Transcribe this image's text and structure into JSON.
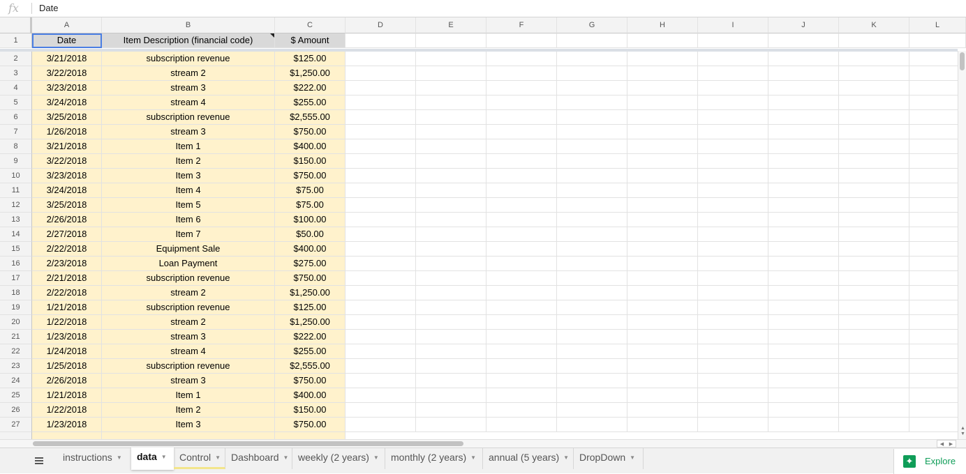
{
  "formula_bar": {
    "fx_label": "fx",
    "value": "Date"
  },
  "columns": [
    "A",
    "B",
    "C",
    "D",
    "E",
    "F",
    "G",
    "H",
    "I",
    "J",
    "K",
    "L"
  ],
  "header_row": {
    "row_num": "1",
    "date": "Date",
    "desc": "Item Description (financial code)",
    "amount": "$ Amount"
  },
  "rows": [
    {
      "n": "2",
      "date": "3/21/2018",
      "desc": "subscription revenue",
      "amount": "$125.00"
    },
    {
      "n": "3",
      "date": "3/22/2018",
      "desc": "stream 2",
      "amount": "$1,250.00"
    },
    {
      "n": "4",
      "date": "3/23/2018",
      "desc": "stream 3",
      "amount": "$222.00"
    },
    {
      "n": "5",
      "date": "3/24/2018",
      "desc": "stream 4",
      "amount": "$255.00"
    },
    {
      "n": "6",
      "date": "3/25/2018",
      "desc": "subscription revenue",
      "amount": "$2,555.00"
    },
    {
      "n": "7",
      "date": "1/26/2018",
      "desc": "stream 3",
      "amount": "$750.00"
    },
    {
      "n": "8",
      "date": "3/21/2018",
      "desc": "Item 1",
      "amount": "$400.00"
    },
    {
      "n": "9",
      "date": "3/22/2018",
      "desc": "Item 2",
      "amount": "$150.00"
    },
    {
      "n": "10",
      "date": "3/23/2018",
      "desc": "Item 3",
      "amount": "$750.00"
    },
    {
      "n": "11",
      "date": "3/24/2018",
      "desc": "Item 4",
      "amount": "$75.00"
    },
    {
      "n": "12",
      "date": "3/25/2018",
      "desc": "Item 5",
      "amount": "$75.00"
    },
    {
      "n": "13",
      "date": "2/26/2018",
      "desc": "Item 6",
      "amount": "$100.00"
    },
    {
      "n": "14",
      "date": "2/27/2018",
      "desc": "Item 7",
      "amount": "$50.00"
    },
    {
      "n": "15",
      "date": "2/22/2018",
      "desc": "Equipment Sale",
      "amount": "$400.00"
    },
    {
      "n": "16",
      "date": "2/23/2018",
      "desc": "Loan Payment",
      "amount": "$275.00"
    },
    {
      "n": "17",
      "date": "2/21/2018",
      "desc": "subscription revenue",
      "amount": "$750.00"
    },
    {
      "n": "18",
      "date": "2/22/2018",
      "desc": "stream 2",
      "amount": "$1,250.00"
    },
    {
      "n": "19",
      "date": "1/21/2018",
      "desc": "subscription revenue",
      "amount": "$125.00"
    },
    {
      "n": "20",
      "date": "1/22/2018",
      "desc": "stream 2",
      "amount": "$1,250.00"
    },
    {
      "n": "21",
      "date": "1/23/2018",
      "desc": "stream 3",
      "amount": "$222.00"
    },
    {
      "n": "22",
      "date": "1/24/2018",
      "desc": "stream 4",
      "amount": "$255.00"
    },
    {
      "n": "23",
      "date": "1/25/2018",
      "desc": "subscription revenue",
      "amount": "$2,555.00"
    },
    {
      "n": "24",
      "date": "2/26/2018",
      "desc": "stream 3",
      "amount": "$750.00"
    },
    {
      "n": "25",
      "date": "1/21/2018",
      "desc": "Item 1",
      "amount": "$400.00"
    },
    {
      "n": "26",
      "date": "1/22/2018",
      "desc": "Item 2",
      "amount": "$150.00"
    },
    {
      "n": "27",
      "date": "1/23/2018",
      "desc": "Item 3",
      "amount": "$750.00"
    }
  ],
  "tabs": [
    {
      "label": "instructions"
    },
    {
      "label": "data"
    },
    {
      "label": "Control"
    },
    {
      "label": "Dashboard"
    },
    {
      "label": "weekly (2 years)"
    },
    {
      "label": "monthly (2 years)"
    },
    {
      "label": "annual (5 years)"
    },
    {
      "label": "DropDown"
    }
  ],
  "explore": {
    "label": "Explore",
    "icon": "explore-icon"
  },
  "colors": {
    "data_fill": "#fff2cc",
    "header_fill": "#d9d9d9",
    "selection": "#4a7ee3",
    "explore_green": "#0f9d58"
  }
}
